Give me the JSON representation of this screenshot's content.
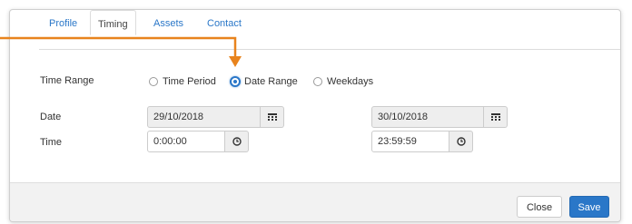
{
  "tabs": [
    {
      "label": "Profile",
      "active": false
    },
    {
      "label": "Timing",
      "active": true
    },
    {
      "label": "Assets",
      "active": false
    },
    {
      "label": "Contact",
      "active": false
    }
  ],
  "time_range": {
    "label": "Time Range",
    "options": [
      {
        "label": "Time Period",
        "checked": false
      },
      {
        "label": "Date Range",
        "checked": true
      },
      {
        "label": "Weekdays",
        "checked": false
      }
    ]
  },
  "date": {
    "label": "Date",
    "start_value": "29/10/2018",
    "end_value": "30/10/2018",
    "icon": "calendar-icon"
  },
  "time": {
    "label": "Time",
    "start_value": "0:00:00",
    "end_value": "23:59:59",
    "icon": "clock-icon"
  },
  "footer": {
    "close_label": "Close",
    "save_label": "Save"
  },
  "colors": {
    "accent": "#2a77c8",
    "callout": "#e8831d"
  }
}
